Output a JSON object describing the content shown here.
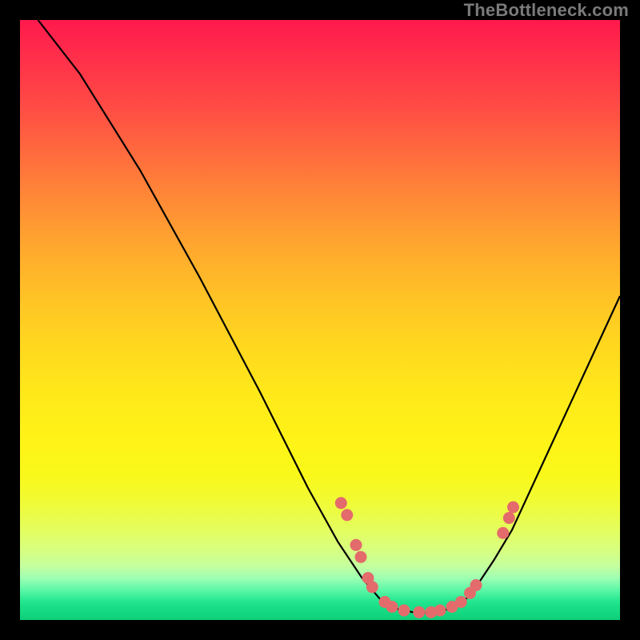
{
  "watermark": "TheBottleneck.com",
  "colors": {
    "background": "#000000",
    "curve_stroke": "#000000",
    "marker_fill": "#e46b6b",
    "marker_stroke": "#c95959"
  },
  "chart_data": {
    "type": "line",
    "title": "",
    "xlabel": "",
    "ylabel": "",
    "xlim": [
      0,
      100
    ],
    "ylim": [
      0,
      100
    ],
    "grid": false,
    "legend": false,
    "curve": [
      {
        "x": 3,
        "y": 100
      },
      {
        "x": 10,
        "y": 91
      },
      {
        "x": 20,
        "y": 75
      },
      {
        "x": 30,
        "y": 57
      },
      {
        "x": 40,
        "y": 38
      },
      {
        "x": 48,
        "y": 22
      },
      {
        "x": 53,
        "y": 13
      },
      {
        "x": 57,
        "y": 7
      },
      {
        "x": 60,
        "y": 3.5
      },
      {
        "x": 63,
        "y": 1.8
      },
      {
        "x": 66,
        "y": 1.2
      },
      {
        "x": 69,
        "y": 1.2
      },
      {
        "x": 72,
        "y": 2
      },
      {
        "x": 75,
        "y": 4
      },
      {
        "x": 79,
        "y": 10
      },
      {
        "x": 82,
        "y": 15
      },
      {
        "x": 88,
        "y": 28
      },
      {
        "x": 94,
        "y": 41
      },
      {
        "x": 100,
        "y": 54
      }
    ],
    "markers": [
      {
        "x": 53.5,
        "y": 19.5
      },
      {
        "x": 54.5,
        "y": 17.5
      },
      {
        "x": 56.0,
        "y": 12.5
      },
      {
        "x": 56.8,
        "y": 10.5
      },
      {
        "x": 58.0,
        "y": 7.0
      },
      {
        "x": 58.7,
        "y": 5.5
      },
      {
        "x": 60.8,
        "y": 3.0
      },
      {
        "x": 62.0,
        "y": 2.2
      },
      {
        "x": 64.0,
        "y": 1.6
      },
      {
        "x": 66.5,
        "y": 1.3
      },
      {
        "x": 68.5,
        "y": 1.3
      },
      {
        "x": 70.0,
        "y": 1.6
      },
      {
        "x": 72.0,
        "y": 2.2
      },
      {
        "x": 73.5,
        "y": 3.0
      },
      {
        "x": 75.0,
        "y": 4.5
      },
      {
        "x": 76.0,
        "y": 5.8
      },
      {
        "x": 80.5,
        "y": 14.5
      },
      {
        "x": 81.5,
        "y": 17.0
      },
      {
        "x": 82.2,
        "y": 18.8
      }
    ]
  }
}
